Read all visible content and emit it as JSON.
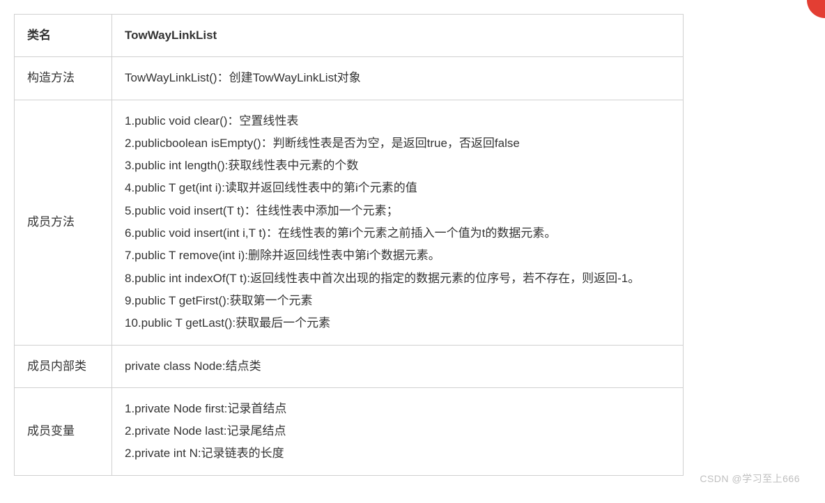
{
  "header": {
    "col1": "类名",
    "col2": "TowWayLinkList"
  },
  "rows": {
    "constructor": {
      "label": "构造方法",
      "content": "TowWayLinkList()：创建TowWayLinkList对象"
    },
    "methods": {
      "label": "成员方法",
      "items": [
        "1.public void clear()：空置线性表",
        "2.publicboolean isEmpty()：判断线性表是否为空，是返回true，否返回false",
        "3.public int length():获取线性表中元素的个数",
        "4.public T get(int i):读取并返回线性表中的第i个元素的值",
        "5.public void insert(T t)：往线性表中添加一个元素；",
        "6.public void insert(int i,T t)：在线性表的第i个元素之前插入一个值为t的数据元素。",
        "7.public T remove(int i):删除并返回线性表中第i个数据元素。",
        "8.public int indexOf(T t):返回线性表中首次出现的指定的数据元素的位序号，若不存在，则返回-1。",
        "9.public T getFirst():获取第一个元素",
        "10.public T getLast():获取最后一个元素"
      ]
    },
    "innerClass": {
      "label": "成员内部类",
      "content": "private class Node:结点类"
    },
    "fields": {
      "label": "成员变量",
      "items": [
        "1.private Node first:记录首结点",
        "2.private Node last:记录尾结点",
        "2.private int N:记录链表的长度"
      ]
    }
  },
  "watermark": "CSDN @学习至上666"
}
